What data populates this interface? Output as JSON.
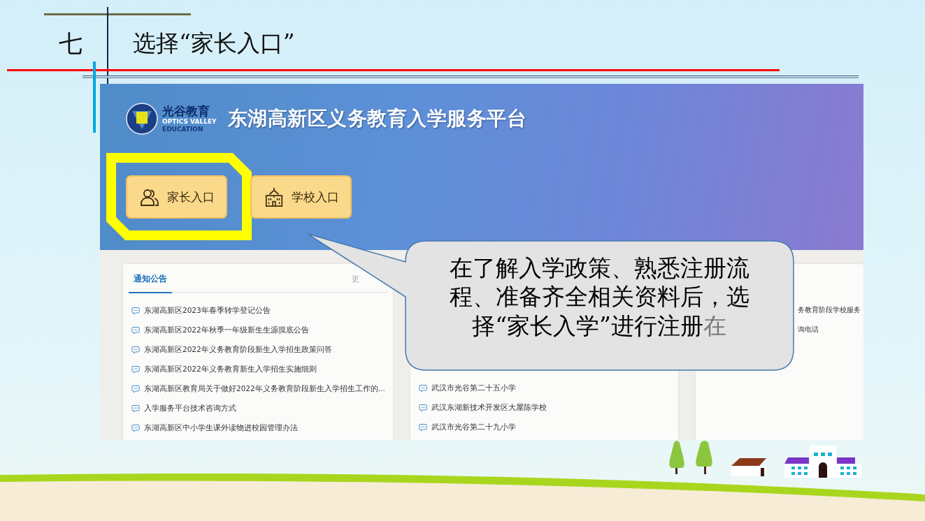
{
  "slide": {
    "number": "七",
    "title": "选择“家长入口”"
  },
  "site": {
    "logo_name": "光谷教育",
    "logo_english_1": "OPTICS VALLEY",
    "logo_english_2": "EDUCATION",
    "title": "东湖高新区义务教育入学服务平台",
    "entry_buttons": [
      {
        "label": "家长入口",
        "kind": "parent",
        "highlighted": true
      },
      {
        "label": "学校入口",
        "kind": "school",
        "highlighted": false
      }
    ]
  },
  "panels": [
    {
      "kind": "tabbed",
      "tabs": [
        {
          "label": "通知公告",
          "selected": true
        }
      ],
      "more_link": "更",
      "items": [
        "东湖高新区2023年春季转学登记公告",
        "东湖高新区2022年秋季一年级新生生源摸底公告",
        "东湖高新区2022年义务教育阶段新生入学招生政策问答",
        "东湖高新区2022年义务教育新生入学招生实施细则",
        "东湖高新区教育局关于做好2022年义务教育阶段新生入学招生工作的...",
        "入学服务平台技术咨询方式",
        "东湖高新区中小学生课外读物进校园管理办法"
      ]
    },
    {
      "kind": "covered_top",
      "items": [
        "武汉市光谷第二十五小学",
        "武汉东湖新技术开发区大屋陈学校",
        "武汉市光谷第二十九小学"
      ]
    },
    {
      "kind": "covered_left",
      "items": [
        "务教育阶段学校服务",
        "询电话"
      ]
    }
  ],
  "callout": {
    "text": "在了解入学政策、熟悉注册流程、准备齐全相关资料后，选择“家长入学”进行注册",
    "faded_text": "在"
  }
}
